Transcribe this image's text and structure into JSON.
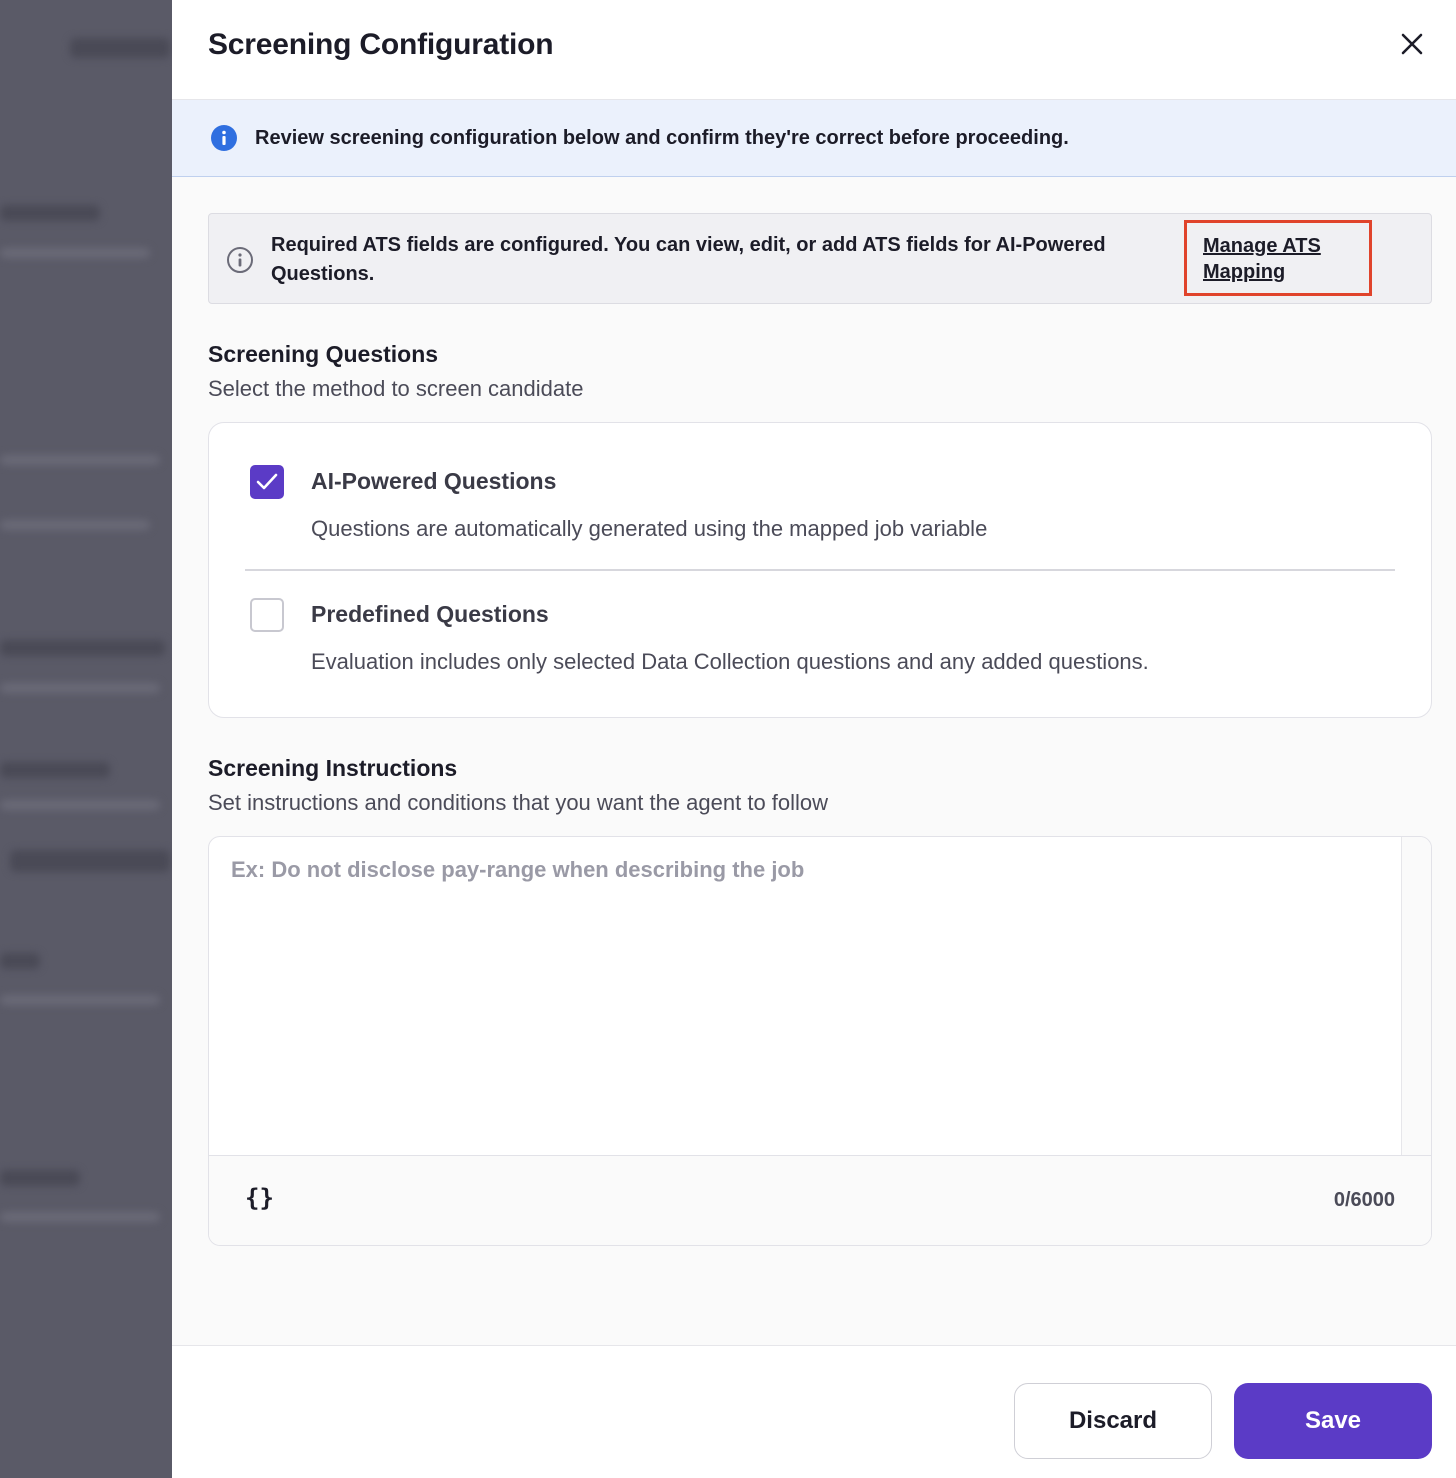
{
  "drawer": {
    "title": "Screening Configuration",
    "close_icon": "close-icon"
  },
  "banner": {
    "icon": "info-filled-icon",
    "text": "Review screening configuration below and confirm they're correct before proceeding."
  },
  "ats": {
    "icon": "info-outline-icon",
    "text": "Required ATS fields are configured. You can view, edit, or add ATS fields for AI-Powered Questions.",
    "link": "Manage ATS Mapping"
  },
  "screening_questions": {
    "title": "Screening Questions",
    "subtitle": "Select the method to screen candidate",
    "options": [
      {
        "title": "AI-Powered Questions",
        "description": "Questions are automatically generated using the mapped job variable",
        "checked": true
      },
      {
        "title": "Predefined Questions",
        "description": "Evaluation includes only selected Data Collection questions and any added questions.",
        "checked": false
      }
    ]
  },
  "screening_instructions": {
    "title": "Screening Instructions",
    "subtitle": "Set instructions and conditions that you want the agent to follow",
    "placeholder": "Ex: Do not disclose pay-range when describing the job",
    "value": "",
    "variable_icon": "{}",
    "counter": "0/6000"
  },
  "footer": {
    "discard_label": "Discard",
    "save_label": "Save"
  },
  "colors": {
    "accent": "#5b3bc6",
    "banner_bg": "#ebf1fc",
    "info_icon": "#2f6fe0",
    "highlight_border": "#e0432b"
  }
}
